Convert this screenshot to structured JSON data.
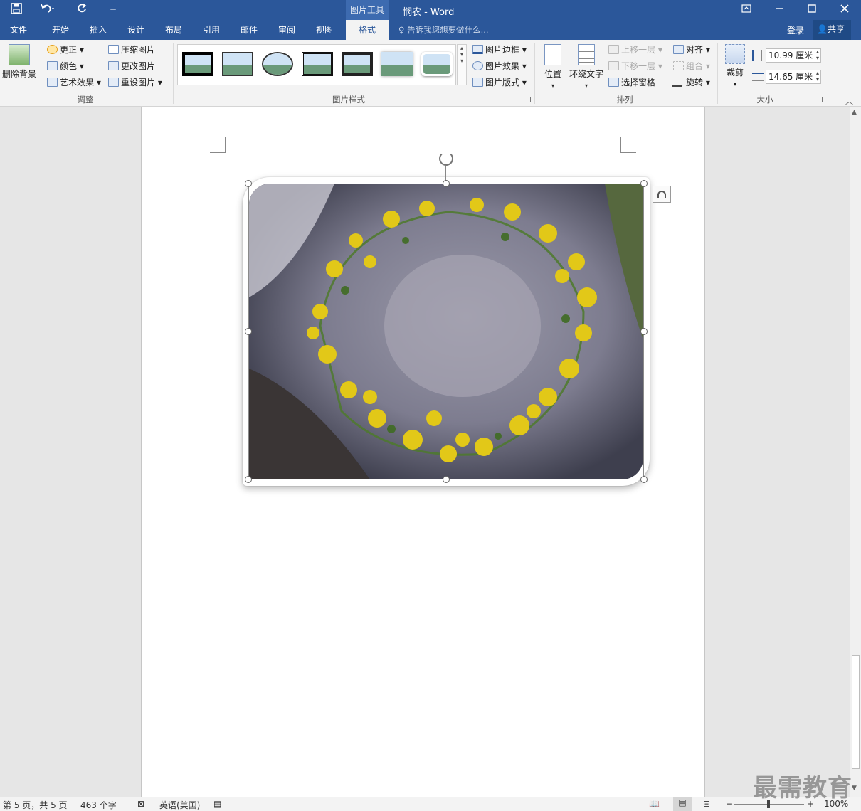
{
  "titlebar": {
    "context_tab": "图片工具",
    "document_title": "悯农 - Word",
    "customize_glyph": "="
  },
  "tabs": [
    {
      "label": "文件"
    },
    {
      "label": "开始"
    },
    {
      "label": "插入"
    },
    {
      "label": "设计"
    },
    {
      "label": "布局"
    },
    {
      "label": "引用"
    },
    {
      "label": "邮件"
    },
    {
      "label": "审阅"
    },
    {
      "label": "视图"
    },
    {
      "label": "格式"
    }
  ],
  "tell_me": "告诉我您想要做什么...",
  "account": {
    "login": "登录",
    "share": "共享"
  },
  "ribbon": {
    "adjust": {
      "remove_bg": "删除背景",
      "corrections": "更正",
      "color": "颜色",
      "artistic": "艺术效果",
      "compress": "压缩图片",
      "change": "更改图片",
      "reset": "重设图片",
      "label": "调整"
    },
    "styles": {
      "border": "图片边框",
      "effects": "图片效果",
      "layout": "图片版式",
      "label": "图片样式"
    },
    "arrange": {
      "position": "位置",
      "wrap": "环绕文字",
      "forward": "上移一层",
      "backward": "下移一层",
      "selection_pane": "选择窗格",
      "align": "对齐",
      "group": "组合",
      "rotate": "旋转",
      "label": "排列"
    },
    "size": {
      "crop": "裁剪",
      "height": "10.99 厘米",
      "width": "14.65 厘米",
      "label": "大小"
    }
  },
  "status": {
    "page": "第 5 页，共 5 页",
    "words": "463 个字",
    "language": "英语(美国)",
    "zoom": "100%"
  },
  "watermark": "最需教育",
  "colors": {
    "accent": "#2b579a",
    "ribbon": "#f3f3f3"
  }
}
